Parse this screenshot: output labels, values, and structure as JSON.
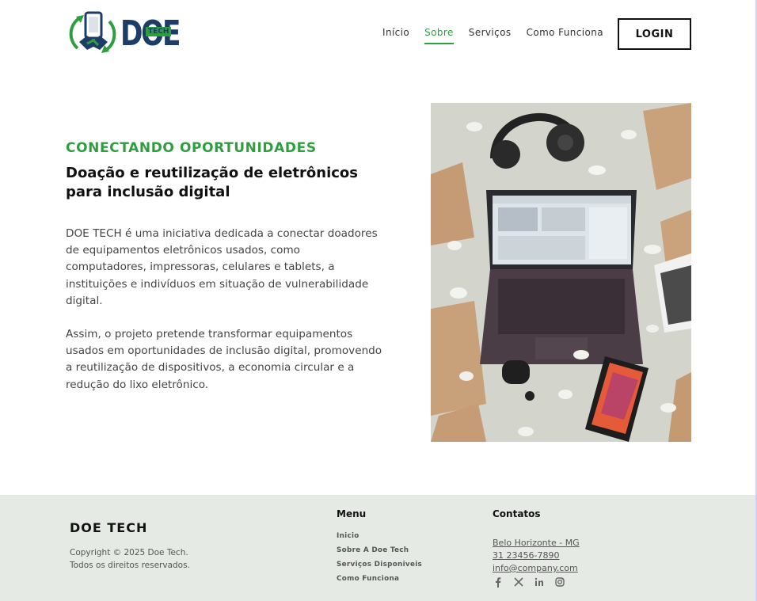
{
  "header": {
    "logo_word": "DOE",
    "logo_badge": "TECH",
    "nav": [
      {
        "label": "Início"
      },
      {
        "label": "Sobre"
      },
      {
        "label": "Serviços"
      },
      {
        "label": "Como Funciona"
      }
    ],
    "active_nav": "Sobre",
    "login_label": "LOGIN"
  },
  "hero": {
    "eyebrow": "CONECTANDO OPORTUNIDADES",
    "headline": "Doação e reutilização de eletrônicos para inclusão digital",
    "paragraph1": "DOE TECH é uma iniciativa dedicada a conectar doadores de equipamentos eletrônicos usados, como computadores, impressoras, celulares e tablets, a instituições e indivíduos em situação de vulnerabilidade digital.",
    "paragraph2": "Assim, o projeto pretende transformar equipamentos usados em oportunidades de inclusão digital, promovendo a reutilização de dispositivos, a economia circular e a redução do lixo eletrônico."
  },
  "footer": {
    "brand": "DOE TECH",
    "copyright_line1": "Copyright © 2025 Doe Tech.",
    "copyright_line2": "Todos os direitos reservados.",
    "menu_title": "Menu",
    "menu": [
      {
        "label": "Inicio"
      },
      {
        "label": "Sobre A Doe Tech"
      },
      {
        "label": "Serviços Disponiveis"
      },
      {
        "label": "Como Funciona"
      }
    ],
    "contacts_title": "Contatos",
    "contacts": [
      {
        "label": "Belo Horizonte - MG"
      },
      {
        "label": "31 23456-7890"
      },
      {
        "label": "info@company.com"
      }
    ],
    "social_icons": [
      "facebook-icon",
      "x-icon",
      "linkedin-icon",
      "instagram-icon"
    ]
  },
  "colors": {
    "accent_green": "#2f9e3f",
    "brand_navy": "#1c3d66",
    "footer_bg": "#e6eae5"
  }
}
